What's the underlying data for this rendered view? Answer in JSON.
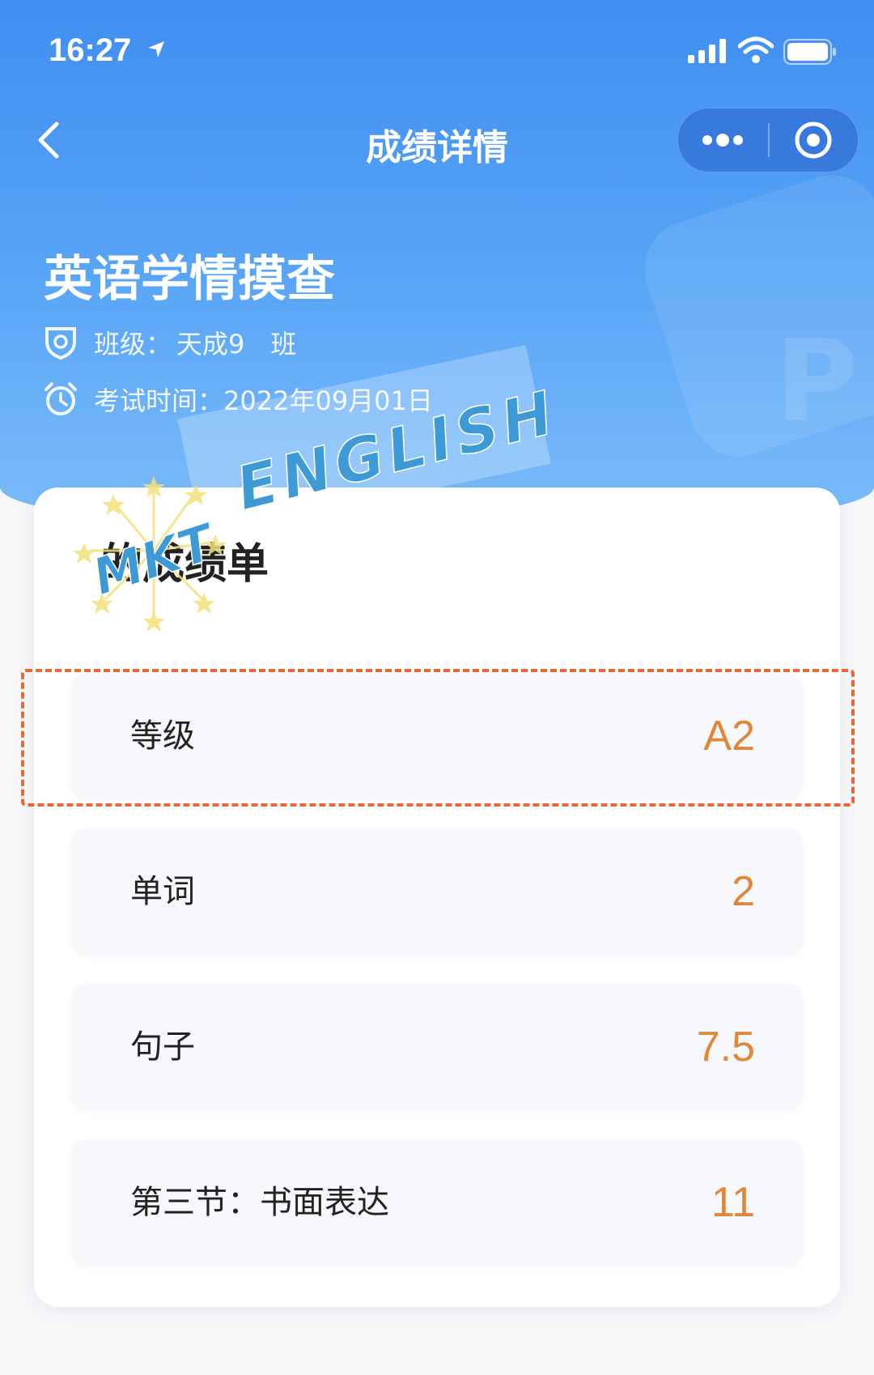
{
  "status_bar": {
    "time": "16:27"
  },
  "nav": {
    "title": "成绩详情"
  },
  "exam": {
    "title": "英语学情摸查",
    "class_label": "班级：",
    "class_value": "天成9　班",
    "time_label": "考试时间：",
    "time_value": "2022年09月01日"
  },
  "card": {
    "title": "的成绩单",
    "rows": [
      {
        "label": "等级",
        "value": "A2"
      },
      {
        "label": "单词",
        "value": "2"
      },
      {
        "label": "句子",
        "value": "7.5"
      },
      {
        "label": "第三节：书面表达",
        "value": "11"
      }
    ]
  },
  "watermark": {
    "text": "ENGLISH",
    "logo_text": "MKT"
  },
  "colors": {
    "header_blue": "#3f8ef2",
    "score_orange": "#e0873a",
    "highlight_dash": "#e8683a"
  },
  "icons": {
    "back": "chevron-left-icon",
    "more": "more-dots-icon",
    "close": "target-circle-icon",
    "class": "badge-shield-icon",
    "time": "alarm-clock-icon"
  }
}
